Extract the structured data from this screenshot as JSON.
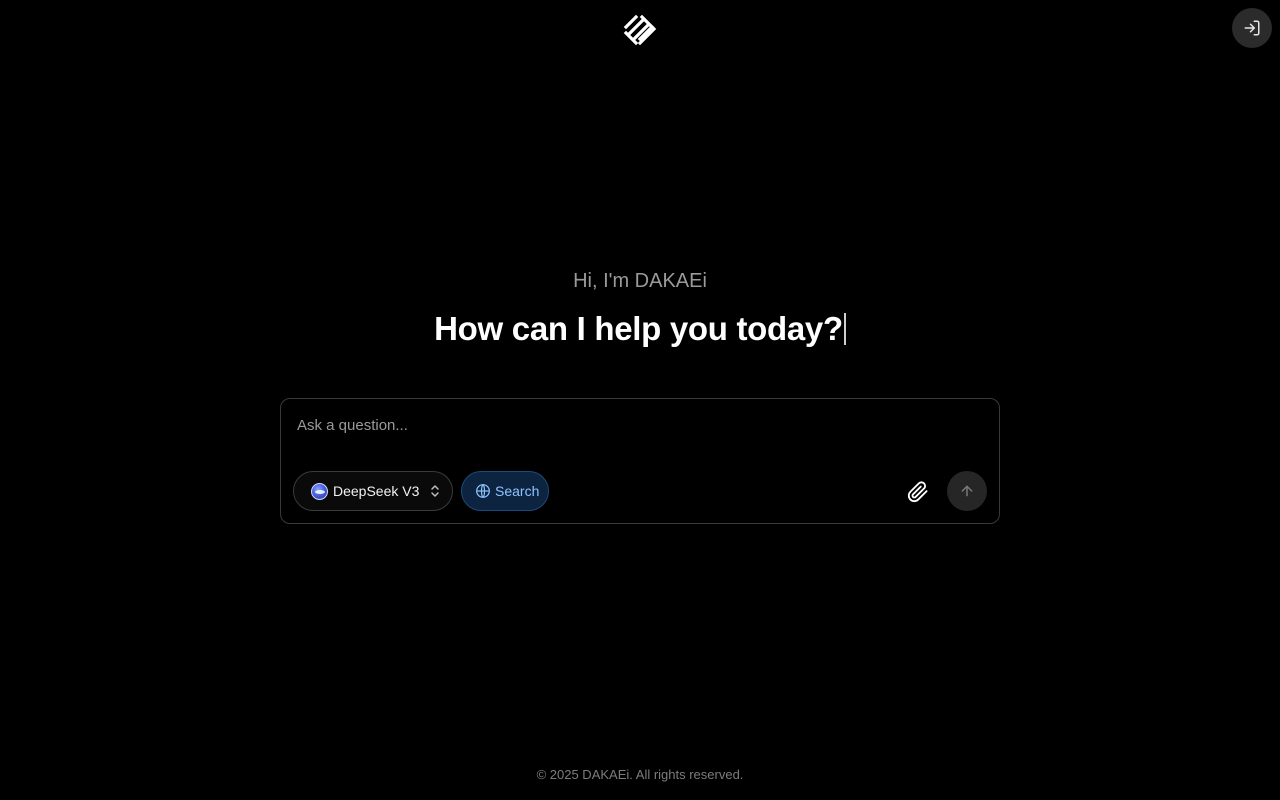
{
  "header": {
    "logo_icon": "dakaei-logo-icon",
    "login_icon": "sign-in-icon"
  },
  "hero": {
    "greeting": "Hi, I'm DAKAEi",
    "headline": "How can I help you today?"
  },
  "composer": {
    "placeholder": "Ask a question...",
    "value": "",
    "model_label": "DeepSeek V3",
    "model_icon": "deepseek-whale-icon",
    "search_label": "Search",
    "search_icon": "globe-icon",
    "attach_icon": "paperclip-icon",
    "send_icon": "arrow-up-icon"
  },
  "footer": {
    "copyright": "© 2025 DAKAEi. All rights reserved."
  },
  "colors": {
    "background": "#000000",
    "accent": "#8fc3ff",
    "search_bg": "#0c2440"
  }
}
